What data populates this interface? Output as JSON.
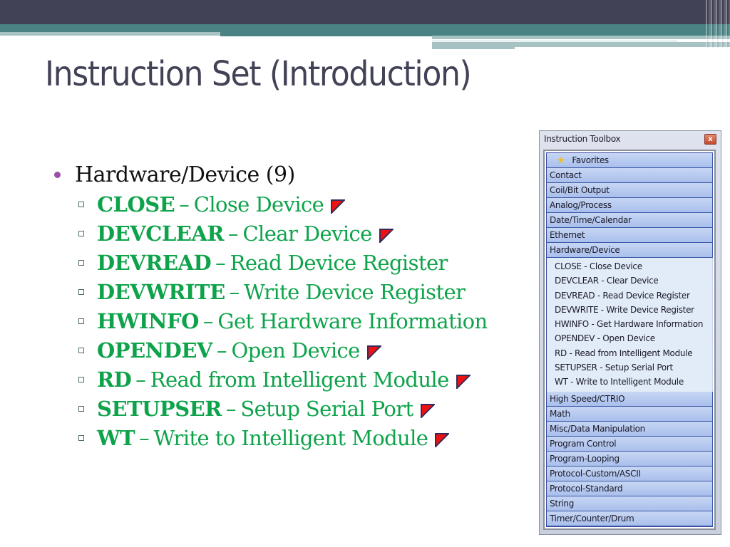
{
  "slide": {
    "title": "Instruction Set (Introduction)",
    "bullet": "Hardware/Device (9)",
    "items": [
      {
        "code": "CLOSE",
        "sep": "–",
        "desc": "Close Device",
        "flag": true
      },
      {
        "code": "DEVCLEAR",
        "sep": "–",
        "desc": "Clear Device",
        "flag": true
      },
      {
        "code": "DEVREAD",
        "sep": "–",
        "desc": "Read Device Register",
        "flag": false
      },
      {
        "code": "DEVWRITE",
        "sep": "–",
        "desc": "Write Device Register",
        "flag": false
      },
      {
        "code": "HWINFO",
        "sep": "–",
        "desc": "Get Hardware Information",
        "flag": false
      },
      {
        "code": "OPENDEV",
        "sep": "–",
        "desc": "Open Device",
        "flag": true
      },
      {
        "code": "RD",
        "sep": "–",
        "desc": "Read from Intelligent Module",
        "flag": true
      },
      {
        "code": "SETUPSER",
        "sep": "–",
        "desc": "Setup Serial Port",
        "flag": true
      },
      {
        "code": "WT",
        "sep": "–",
        "desc": "Write to Intelligent Module",
        "flag": true
      }
    ],
    "colors": {
      "title": "#424256",
      "item_text": "#0ea34b",
      "bullet": "#9a4fa8",
      "flag_fill": "#ee1111",
      "flag_border": "#3a2a5a"
    }
  },
  "toolbox": {
    "title": "Instruction Toolbox",
    "close_label": "x",
    "favorites_label": "Favorites",
    "categories_before": [
      "Contact",
      "Coil/Bit Output",
      "Analog/Process",
      "Date/Time/Calendar",
      "Ethernet",
      "Hardware/Device"
    ],
    "expanded_items": [
      "CLOSE - Close Device",
      "DEVCLEAR - Clear Device",
      "DEVREAD - Read Device Register",
      "DEVWRITE - Write Device Register",
      "HWINFO - Get Hardware Information",
      "OPENDEV - Open Device",
      "RD - Read from Intelligent Module",
      "SETUPSER - Setup Serial Port",
      "WT - Write to Intelligent Module"
    ],
    "categories_after": [
      "High Speed/CTRIO",
      "Math",
      "Misc/Data Manipulation",
      "Program Control",
      "Program-Looping",
      "Protocol-Custom/ASCII",
      "Protocol-Standard",
      "String",
      "Timer/Counter/Drum"
    ]
  }
}
